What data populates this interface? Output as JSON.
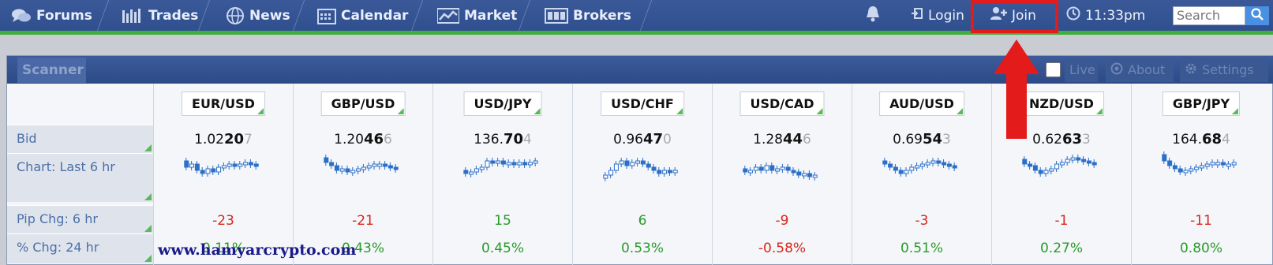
{
  "nav": {
    "tabs": [
      {
        "label": "Forums",
        "icon": "chat-bubbles-icon"
      },
      {
        "label": "Trades",
        "icon": "bars-icon"
      },
      {
        "label": "News",
        "icon": "globe-icon"
      },
      {
        "label": "Calendar",
        "icon": "calendar-icon"
      },
      {
        "label": "Market",
        "icon": "chart-icon"
      },
      {
        "label": "Brokers",
        "icon": "broker-icon"
      }
    ],
    "login_label": "Login",
    "join_label": "Join",
    "time": "11:33pm",
    "search_placeholder": "Search"
  },
  "scanner": {
    "title": "Scanner",
    "live_label": "Live",
    "about_label": "About",
    "settings_label": "Settings"
  },
  "row_labels": {
    "bid": "Bid",
    "chart": "Chart: Last 6 hr",
    "pip": "Pip Chg: 6 hr",
    "pct": "% Chg: 24 hr"
  },
  "pairs": [
    {
      "name": "EUR/USD",
      "bid_pre": "1.02",
      "bid_big": "20",
      "bid_pip": "7",
      "pip_chg": "-23",
      "pct_chg": "0.11%"
    },
    {
      "name": "GBP/USD",
      "bid_pre": "1.20",
      "bid_big": "46",
      "bid_pip": "6",
      "pip_chg": "-21",
      "pct_chg": "0.43%"
    },
    {
      "name": "USD/JPY",
      "bid_pre": "136.",
      "bid_big": "70",
      "bid_pip": "4",
      "pip_chg": "15",
      "pct_chg": "0.45%"
    },
    {
      "name": "USD/CHF",
      "bid_pre": "0.96",
      "bid_big": "47",
      "bid_pip": "0",
      "pip_chg": "6",
      "pct_chg": "0.53%"
    },
    {
      "name": "USD/CAD",
      "bid_pre": "1.28",
      "bid_big": "44",
      "bid_pip": "6",
      "pip_chg": "-9",
      "pct_chg": "-0.58%"
    },
    {
      "name": "AUD/USD",
      "bid_pre": "0.69",
      "bid_big": "54",
      "bid_pip": "3",
      "pip_chg": "-3",
      "pct_chg": "0.51%"
    },
    {
      "name": "NZD/USD",
      "bid_pre": "0.62",
      "bid_big": "63",
      "bid_pip": "3",
      "pip_chg": "-1",
      "pct_chg": "0.27%"
    },
    {
      "name": "GBP/JPY",
      "bid_pre": "164.",
      "bid_big": "68",
      "bid_pip": "4",
      "pip_chg": "-11",
      "pct_chg": "0.80%"
    }
  ],
  "colors": {
    "accent_green": "#3fae3a",
    "negative": "#d9261c",
    "positive": "#2a9a2a",
    "highlight_red": "#e41b1b"
  },
  "watermark": "www.hamyarcrypto.com"
}
